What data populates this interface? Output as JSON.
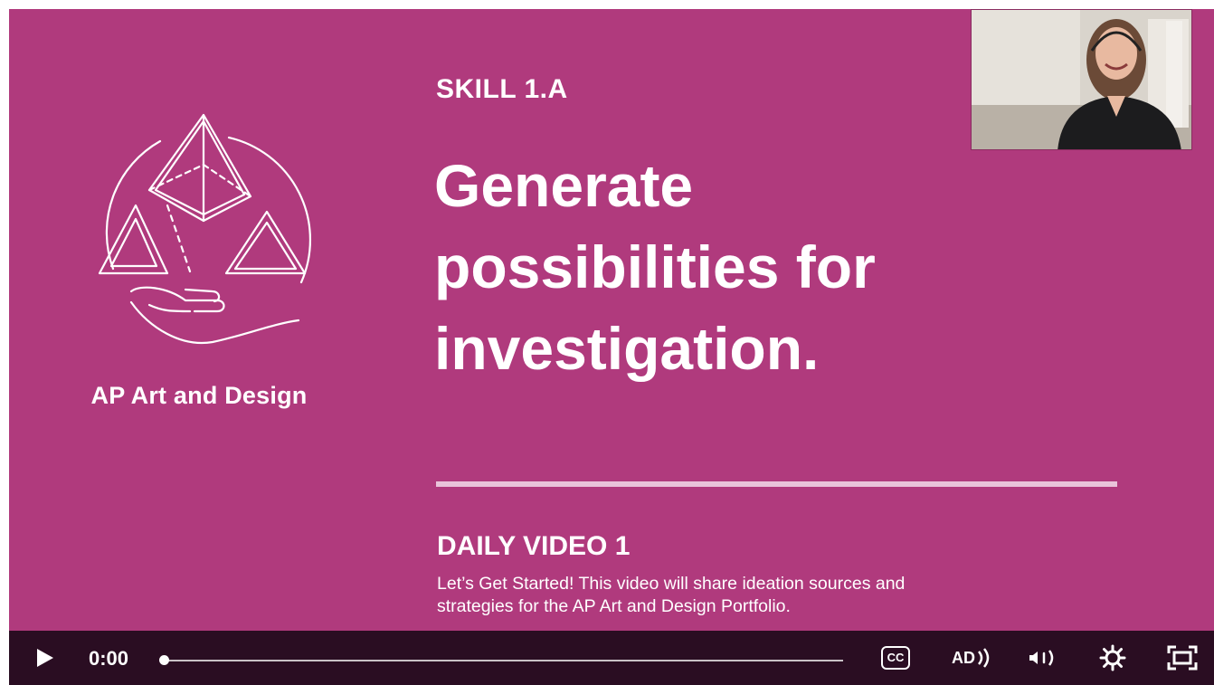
{
  "slide": {
    "brand": "AP Art and Design",
    "skill": "SKILL 1.A",
    "title_lines": [
      "Generate",
      "possibilities for",
      "investigation."
    ],
    "daily_title": "DAILY VIDEO 1",
    "daily_desc_lines": [
      "Let’s Get Started! This video will share ideation sources and",
      "strategies for the AP Art and Design Portfolio."
    ]
  },
  "player": {
    "time": "0:00",
    "progress": 0,
    "cc_label": "CC",
    "ad_label": "AD",
    "icons": {
      "play": "play-icon",
      "cc": "closed-captions-icon",
      "ad": "audio-description-icon",
      "volume": "volume-icon",
      "settings": "gear-icon",
      "fullscreen": "fullscreen-icon"
    }
  },
  "colors": {
    "slide_bg": "#b03a7d",
    "control_bar": "#2a0d22",
    "divider": "#e9c3da"
  }
}
